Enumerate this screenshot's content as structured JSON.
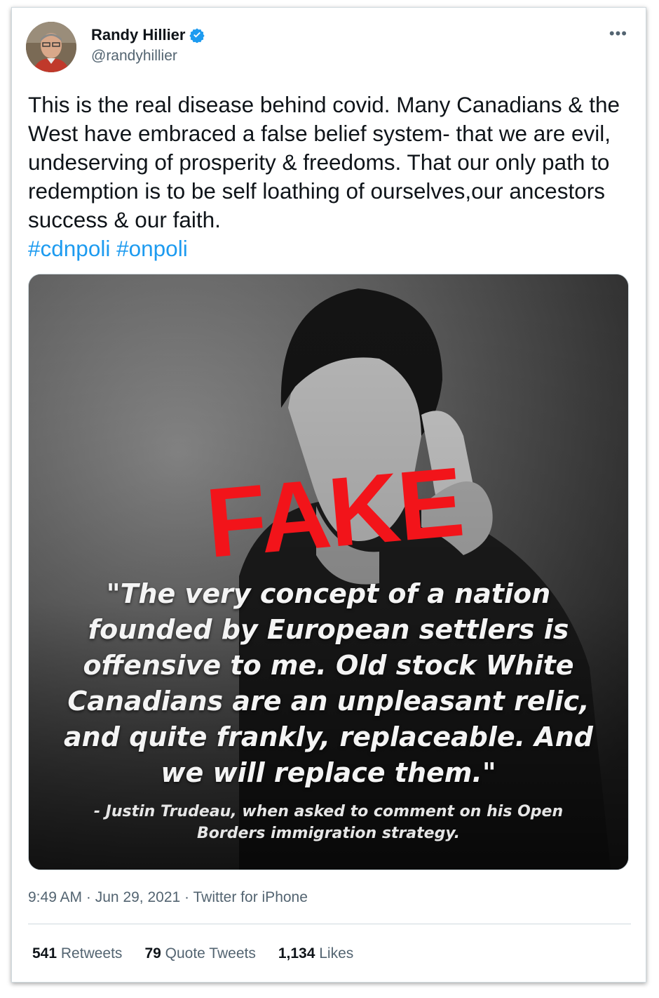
{
  "user": {
    "display_name": "Randy Hillier",
    "handle": "@randyhillier",
    "verified": true
  },
  "tweet": {
    "text": "This is the real disease behind covid. Many Canadians & the West have embraced a false belief system- that we are evil, undeserving of prosperity & freedoms. That our only path to redemption is to be self loathing of ourselves,our ancestors success & our faith.",
    "hashtags": [
      "#cdnpoli",
      "#onpoli"
    ]
  },
  "media": {
    "stamp": "FAKE",
    "quote": "\"The very concept of a nation founded by European settlers is offensive to me. Old stock White Canadians are an unpleasant relic, and quite frankly, replaceable. And we will replace them.\"",
    "attribution": "- Justin Trudeau, when asked to comment on his Open Borders immigration strategy."
  },
  "meta": {
    "time": "9:49 AM",
    "date": "Jun 29, 2021",
    "source": "Twitter for iPhone",
    "separator": "·"
  },
  "stats": {
    "retweets_count": "541",
    "retweets_label": "Retweets",
    "quotes_count": "79",
    "quotes_label": "Quote Tweets",
    "likes_count": "1,134",
    "likes_label": "Likes"
  },
  "icons": {
    "more": "more-icon",
    "verified": "verified-badge-icon"
  },
  "colors": {
    "link": "#1d9bf0",
    "text": "#0f1419",
    "secondary": "#536471",
    "stamp": "#f2141a"
  }
}
